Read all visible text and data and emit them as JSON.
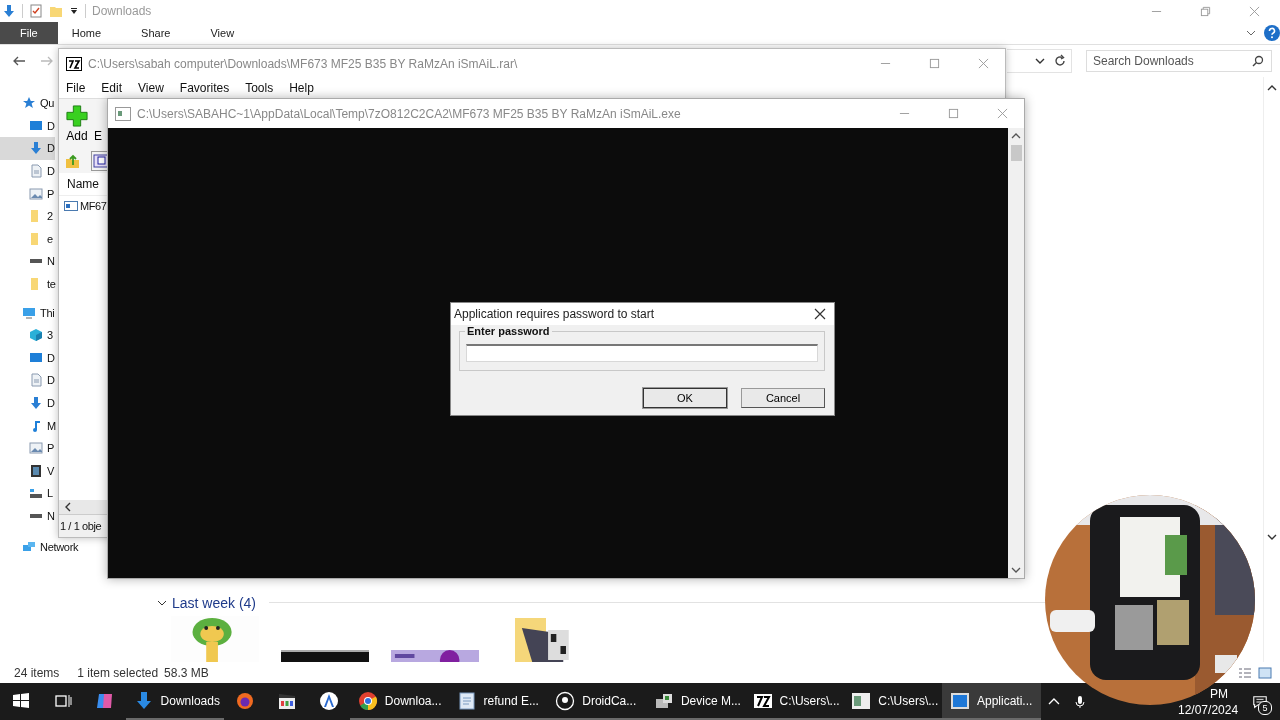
{
  "explorer": {
    "title": "Downloads",
    "ribbon_tabs": [
      {
        "label": "File",
        "selected": true
      },
      {
        "label": "Home",
        "selected": false
      },
      {
        "label": "Share",
        "selected": false
      },
      {
        "label": "View",
        "selected": false
      }
    ],
    "search": {
      "placeholder": "Search Downloads"
    },
    "sidebar": [
      {
        "label": "Qu",
        "kind": "star",
        "selected": false,
        "children": [
          {
            "label": "D",
            "kind": "desktop",
            "selected": false
          },
          {
            "label": "D",
            "kind": "download",
            "selected": true
          },
          {
            "label": "D",
            "kind": "document",
            "selected": false
          },
          {
            "label": "P",
            "kind": "pictures",
            "selected": false
          },
          {
            "label": "2",
            "kind": "folder",
            "selected": false
          },
          {
            "label": "e",
            "kind": "folder",
            "selected": false
          },
          {
            "label": "N",
            "kind": "drive",
            "selected": false
          },
          {
            "label": "te",
            "kind": "folder",
            "selected": false
          }
        ]
      },
      {
        "label": "Thi",
        "kind": "pc",
        "selected": false,
        "children": [
          {
            "label": "3",
            "kind": "cube",
            "selected": false
          },
          {
            "label": "D",
            "kind": "desktop",
            "selected": false
          },
          {
            "label": "D",
            "kind": "document",
            "selected": false
          },
          {
            "label": "D",
            "kind": "download",
            "selected": false
          },
          {
            "label": "M",
            "kind": "music",
            "selected": false
          },
          {
            "label": "P",
            "kind": "pictures",
            "selected": false
          },
          {
            "label": "V",
            "kind": "video",
            "selected": false
          },
          {
            "label": "L",
            "kind": "netdrive",
            "selected": false
          },
          {
            "label": "N",
            "kind": "drive",
            "selected": false
          }
        ]
      },
      {
        "label": "Network",
        "kind": "network",
        "selected": false
      }
    ],
    "group": {
      "label": "Last week (4)",
      "expanded": true
    },
    "status_bar": {
      "count": "24 items",
      "selection": "1 item selected",
      "size": "58.3 MB"
    }
  },
  "archive_window": {
    "title": "C:\\Users\\sabah computer\\Downloads\\MF673 MF25 B35 BY RaMzAn iSmAiL.rar\\",
    "menu": [
      "File",
      "Edit",
      "View",
      "Favorites",
      "Tools",
      "Help"
    ],
    "toolbar": [
      {
        "label": "Add",
        "kind": "add"
      },
      {
        "label": "E",
        "kind": "text"
      }
    ],
    "column": "Name",
    "files": [
      "MF67"
    ],
    "status": "1 / 1 obje"
  },
  "console_window": {
    "title": "C:\\Users\\SABAHC~1\\AppData\\Local\\Temp\\7zO812C2CA2\\MF673 MF25 B35 BY RaMzAn iSmAiL.exe"
  },
  "dialog": {
    "title": "Application requires password to start",
    "group_label": "Enter password",
    "buttons": [
      {
        "label": "OK",
        "default": true
      },
      {
        "label": "Cancel",
        "default": false
      }
    ]
  },
  "taskbar": {
    "items": [
      {
        "kind": "start",
        "selected": false
      },
      {
        "kind": "taskview",
        "selected": false
      },
      {
        "kind": "copilot",
        "selected": false
      },
      {
        "kind": "download",
        "label": "Downloads",
        "selected": false
      },
      {
        "kind": "firefox",
        "selected": false
      },
      {
        "kind": "clapper",
        "selected": false
      },
      {
        "kind": "compass",
        "selected": false
      },
      {
        "kind": "chrome",
        "label": "Downloa...",
        "selected": false
      },
      {
        "kind": "doc",
        "label": "refund E...",
        "selected": false
      },
      {
        "kind": "webcam",
        "label": "DroidCa...",
        "selected": false
      },
      {
        "kind": "devices",
        "label": "Device M...",
        "selected": false
      },
      {
        "kind": "sevenzip",
        "label": "C:\\Users\\...",
        "selected": false
      },
      {
        "kind": "console",
        "label": "C:\\Users\\...",
        "selected": false
      },
      {
        "kind": "app",
        "label": "Applicati...",
        "selected": true
      }
    ],
    "time": "PM",
    "date": "12/07/2024",
    "notifications": "5"
  }
}
